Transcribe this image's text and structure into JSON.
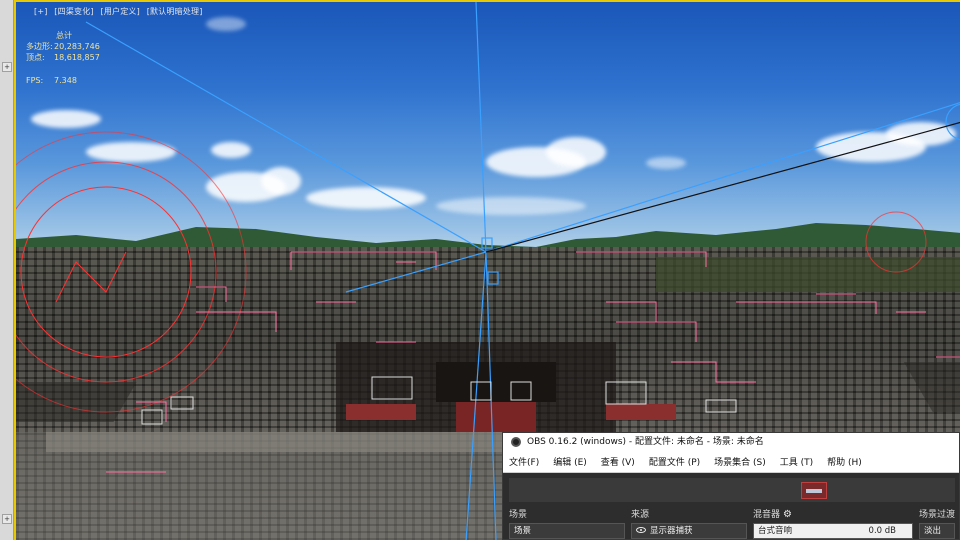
{
  "host_app": {
    "viewport_menu": [
      "[+]",
      "[四渠变化]",
      "[用户定义]",
      "[默认明暗处理]"
    ],
    "stats": {
      "title": "总计",
      "rows": [
        {
          "label": "多边形:",
          "value": "20,283,746"
        },
        {
          "label": "顶点:",
          "value": "18,618,857"
        }
      ],
      "fps_label": "FPS:",
      "fps_value": "7.348"
    },
    "left_strip_buttons": [
      "+",
      "+"
    ]
  },
  "obs": {
    "title": "OBS 0.16.2 (windows) - 配置文件: 未命名 - 场景: 未命名",
    "menu": [
      "文件(F)",
      "编辑 (E)",
      "查看 (V)",
      "配置文件 (P)",
      "场景集合 (S)",
      "工具 (T)",
      "帮助 (H)"
    ],
    "panels": {
      "scenes_header": "场景",
      "sources_header": "来源",
      "mixer_header": "混音器",
      "transitions_header": "场景过渡",
      "scene_item": "场景",
      "source_item": "显示器捕获",
      "mixer_item": "台式音响",
      "mixer_db": "0.0 dB",
      "transition_item": "淡出"
    }
  },
  "colors": {
    "viewport_border": "#e8c800",
    "stats_text": "#f2e49a",
    "gizmo_blue": "#3aa0ff",
    "gizmo_red": "#ff3030"
  }
}
